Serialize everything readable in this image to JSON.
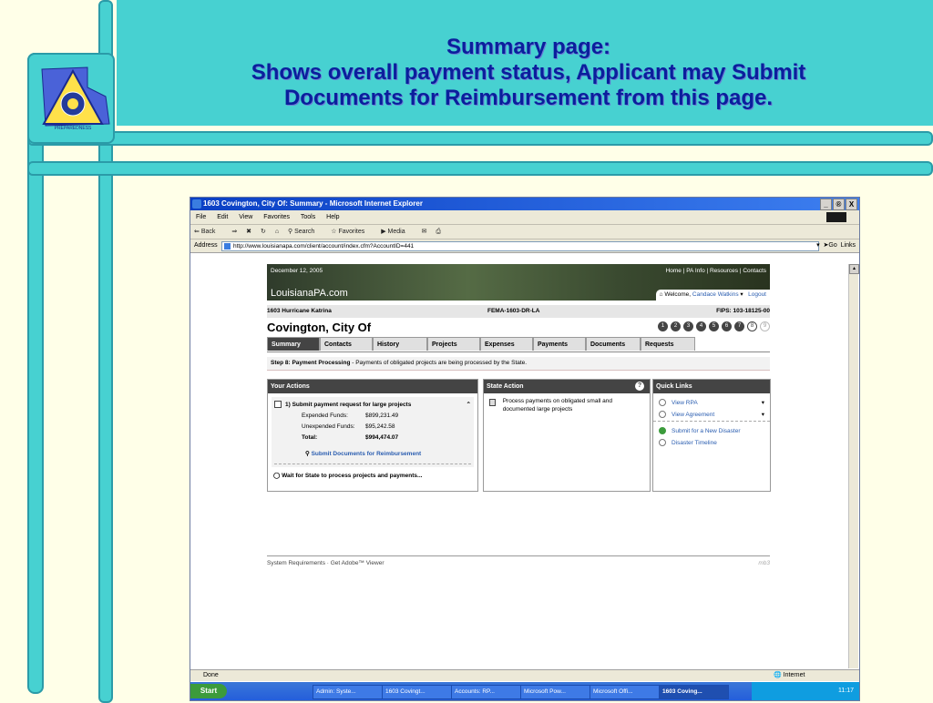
{
  "slide": {
    "title_line1": "Summary page:",
    "title_line2": "Shows overall payment status, Applicant may Submit",
    "title_line3": "Documents for Reimbursement from this page.",
    "logo_caption": "PREPAREDNESS",
    "colors": {
      "teal": "#47D1D1",
      "title": "#0A1F9C",
      "background": "#FFFFE8"
    }
  },
  "browser": {
    "window_title": "1603 Covington, City Of: Summary - Microsoft Internet Explorer",
    "window_buttons": [
      "_",
      "®",
      "X"
    ],
    "menu": [
      "File",
      "Edit",
      "View",
      "Favorites",
      "Tools",
      "Help"
    ],
    "toolbar": [
      "Back",
      "Search",
      "Favorites",
      "Media"
    ],
    "address_label": "Address",
    "address_url": "http://www.louisianapa.com/client/account/index.cfm?AccountID=441",
    "go_label": "Go",
    "links_label": "Links",
    "status_text": "Done",
    "zone_text": "Internet"
  },
  "page": {
    "date": "December 12, 2005",
    "top_links": "Home | PA Info | Resources | Contacts",
    "site_name": "LouisianaPA.com",
    "welcome_prefix": "Welcome,",
    "welcome_user": "Candace Watkins",
    "logout_label": "Logout",
    "disaster": "1603 Hurricane Katrina",
    "fema": "FEMA-1603-DR-LA",
    "fips": "FIPS: 103-18125-00",
    "applicant": "Covington, City Of",
    "steps": [
      "1",
      "2",
      "3",
      "4",
      "5",
      "6",
      "7",
      "8",
      "9"
    ],
    "tabs": [
      "Summary",
      "Contacts",
      "History",
      "Projects",
      "Expenses",
      "Payments",
      "Documents",
      "Requests"
    ],
    "step_title": "Step 8: Payment Processing",
    "step_desc": " - Payments of obligated projects are being processed by the State.",
    "your_actions": {
      "header": "Your Actions",
      "item1": "1) Submit payment request for large projects",
      "expended_label": "Expended Funds:",
      "expended_value": "$899,231.49",
      "unexpended_label": "Unexpended Funds:",
      "unexpended_value": "$95,242.58",
      "total_label": "Total:",
      "total_value": "$994,474.07",
      "submit_link": "Submit Documents for Reimbursement",
      "wait_text": "Wait for State to process projects and payments..."
    },
    "state_action": {
      "header": "State Action",
      "help_icon": "?",
      "item": "Process payments on obligated small and documented large projects"
    },
    "quick_links": {
      "header": "Quick Links",
      "items": [
        "View RPA",
        "View Agreement",
        "Submit for a New Disaster",
        "Disaster Timeline"
      ]
    },
    "footer_text": "System Requirements · Get Adobe™ Viewer",
    "footer_mark": "mb3"
  },
  "taskbar": {
    "start_label": "Start",
    "tasks": [
      "Admin: Syste...",
      "1603 Covingt...",
      "Accounts: RP...",
      "Microsoft Pow...",
      "Microsoft Offi...",
      "1603 Coving..."
    ],
    "clock": "11:17"
  }
}
